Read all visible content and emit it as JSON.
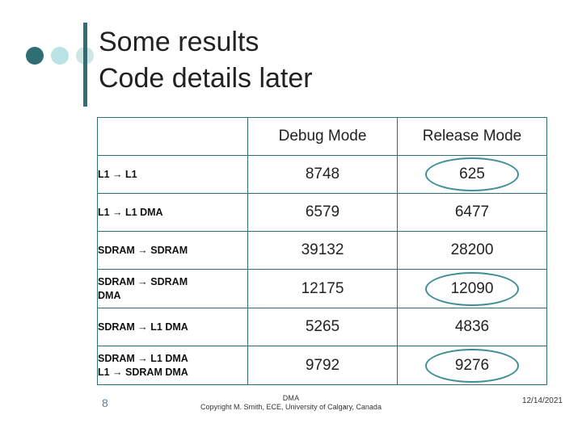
{
  "slide": {
    "title_line1": "Some results",
    "title_line2": "Code details later",
    "slide_number": "8",
    "footer": {
      "label": "DMA",
      "copyright": "Copyright M. Smith, ECE, University of Calgary, Canada",
      "separator": ".",
      "date": "12/14/2021"
    }
  },
  "table": {
    "corner_header": "",
    "headers": [
      "Debug Mode",
      "Release Mode"
    ],
    "rows": [
      {
        "label": "L1 → L1",
        "label2": "",
        "debug": "8748",
        "release": "625",
        "debug_highlight": false,
        "release_highlight": true
      },
      {
        "label": "L1 → L1 DMA",
        "label2": "",
        "debug": "6579",
        "release": "6477",
        "debug_highlight": false,
        "release_highlight": false
      },
      {
        "label": "SDRAM → SDRAM",
        "label2": "",
        "debug": "39132",
        "release": "28200",
        "debug_highlight": false,
        "release_highlight": false
      },
      {
        "label": "SDRAM → SDRAM",
        "label2": "DMA",
        "debug": "12175",
        "release": "12090",
        "debug_highlight": false,
        "release_highlight": true
      },
      {
        "label": "SDRAM → L1 DMA",
        "label2": "",
        "debug": "5265",
        "release": "4836",
        "debug_highlight": false,
        "release_highlight": false
      },
      {
        "label": "SDRAM → L1 DMA",
        "label2": "L1 → SDRAM DMA",
        "debug": "9792",
        "release": "9276",
        "debug_highlight": false,
        "release_highlight": true
      }
    ]
  },
  "colors": {
    "accent": "#2f6f74",
    "accent_light": "#b9e3e4",
    "accent_lighter": "#cfe5e6",
    "highlight_ring": "#3f8e95"
  }
}
